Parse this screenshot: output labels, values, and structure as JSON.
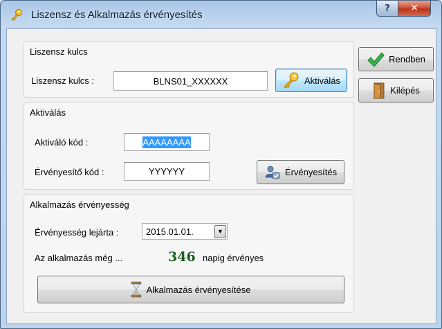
{
  "window": {
    "title": "Liszensz és Alkalmazás érvényesítés",
    "help_label": "?",
    "close_label": "✕"
  },
  "license_group": {
    "title": "Liszensz kulcs",
    "key_label": "Liszensz kulcs :",
    "key_value": "BLNS01_XXXXXX",
    "activate_button": "Aktiválás"
  },
  "activation_group": {
    "title": "Aktiválás",
    "activation_code_label": "Aktiváló kód :",
    "activation_code_value": "AAAAAAAA",
    "validation_code_label": "Érvényesítő kód :",
    "validation_code_value": "YYYYYY",
    "validate_button": "Érvényesítés"
  },
  "validity_group": {
    "title": "Alkalmazás érvényesség",
    "expiry_label": "Érvényesség lejárta :",
    "expiry_value": "2015.01.01.",
    "remaining_prefix": "Az alkalmazás még ...",
    "remaining_days": "346",
    "remaining_suffix": "napig érvényes",
    "apply_button": "Alkalmazás érvényesítése"
  },
  "side_buttons": {
    "ok_label": "Rendben",
    "exit_label": "Kilépés"
  },
  "colors": {
    "selection": "#3399ff",
    "days_number": "#1b5e20",
    "close_button": "#c8432b"
  },
  "icons": {
    "title": "key-icon",
    "activate": "key-icon",
    "validate": "user-validate-icon",
    "apply": "hourglass-icon",
    "ok": "checkmark-icon",
    "exit": "door-exit-icon",
    "combo": "chevron-down-icon"
  }
}
